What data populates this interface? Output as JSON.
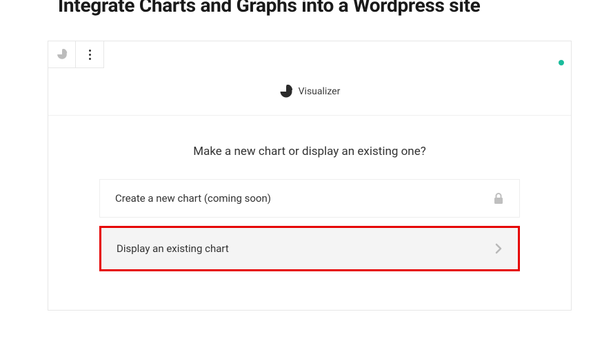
{
  "page": {
    "title": "Integrate Charts and Graphs into a Wordpress site"
  },
  "block": {
    "header_label": "Visualizer",
    "prompt": "Make a new chart or display an existing one?",
    "options": {
      "create": "Create a new chart (coming soon)",
      "display": "Display an existing chart"
    }
  }
}
